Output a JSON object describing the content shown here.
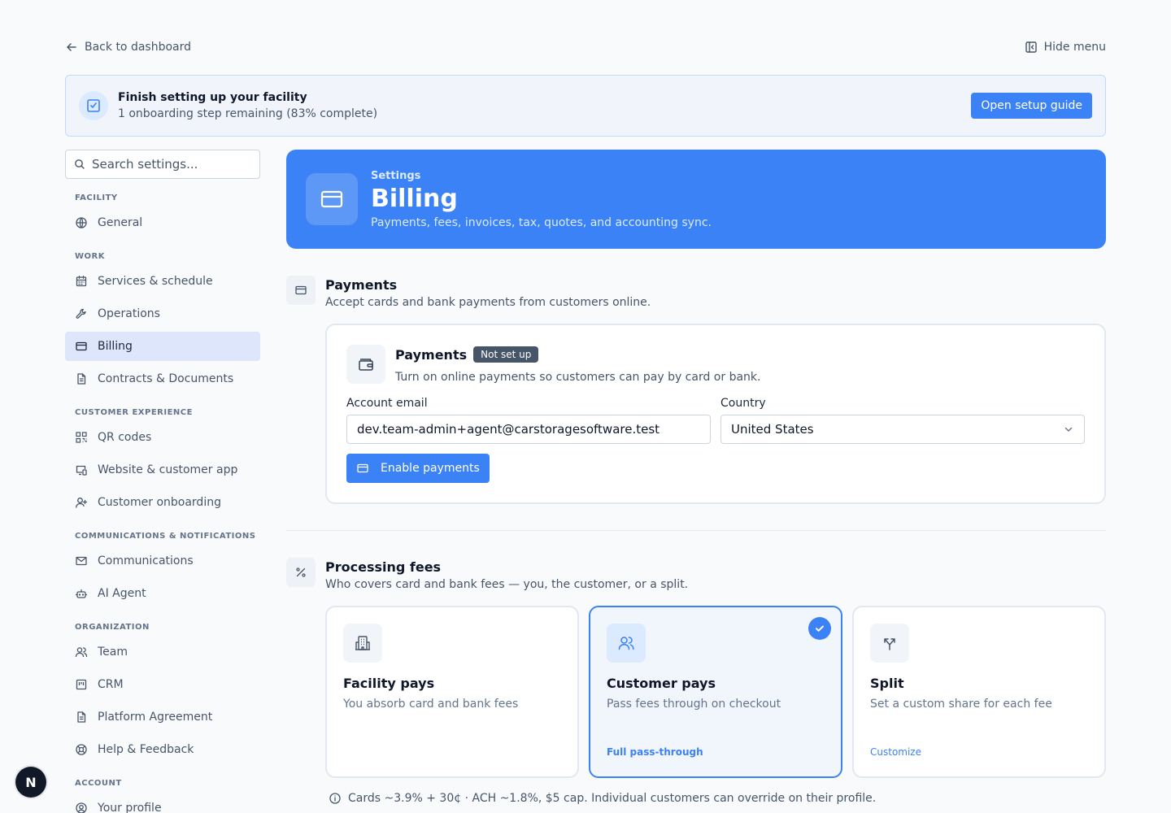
{
  "topbar": {
    "back_label": "Back to dashboard",
    "hide_menu_label": "Hide menu"
  },
  "banner": {
    "title": "Finish setting up your facility",
    "subtitle": "1 onboarding step remaining (83% complete)",
    "button_label": "Open setup guide"
  },
  "sidebar": {
    "search_placeholder": "Search settings...",
    "groups": [
      {
        "label": "FACILITY",
        "items": [
          {
            "label": "General",
            "icon": "globe-icon"
          }
        ]
      },
      {
        "label": "WORK",
        "items": [
          {
            "label": "Services & schedule",
            "icon": "calendar-icon"
          },
          {
            "label": "Operations",
            "icon": "wrench-icon"
          },
          {
            "label": "Billing",
            "icon": "credit-card-icon",
            "active": true
          },
          {
            "label": "Contracts & Documents",
            "icon": "document-icon"
          }
        ]
      },
      {
        "label": "CUSTOMER EXPERIENCE",
        "items": [
          {
            "label": "QR codes",
            "icon": "qr-code-icon"
          },
          {
            "label": "Website & customer app",
            "icon": "devices-icon"
          },
          {
            "label": "Customer onboarding",
            "icon": "user-plus-icon"
          }
        ]
      },
      {
        "label": "COMMUNICATIONS & NOTIFICATIONS",
        "items": [
          {
            "label": "Communications",
            "icon": "mail-icon"
          },
          {
            "label": "AI Agent",
            "icon": "bot-icon"
          }
        ]
      },
      {
        "label": "ORGANIZATION",
        "items": [
          {
            "label": "Team",
            "icon": "users-icon"
          },
          {
            "label": "CRM",
            "icon": "crm-icon"
          },
          {
            "label": "Platform Agreement",
            "icon": "document-icon"
          },
          {
            "label": "Help & Feedback",
            "icon": "lifebuoy-icon"
          }
        ]
      },
      {
        "label": "ACCOUNT",
        "items": [
          {
            "label": "Your profile",
            "icon": "user-circle-icon"
          }
        ]
      }
    ]
  },
  "avatar": {
    "initial": "N"
  },
  "hero": {
    "eyebrow": "Settings",
    "title": "Billing",
    "subtitle": "Payments, fees, invoices, tax, quotes, and accounting sync."
  },
  "payments_section": {
    "title": "Payments",
    "subtitle": "Accept cards and bank payments from customers online.",
    "card": {
      "title": "Payments",
      "badge": "Not set up",
      "subtitle": "Turn on online payments so customers can pay by card or bank.",
      "email_label": "Account email",
      "email_value": "dev.team-admin+agent@carstoragesoftware.test",
      "country_label": "Country",
      "country_value": "United States",
      "enable_label": "Enable payments"
    }
  },
  "fees_section": {
    "title": "Processing fees",
    "subtitle": "Who covers card and bank fees — you, the customer, or a split.",
    "options": [
      {
        "title": "Facility pays",
        "subtitle": "You absorb card and bank fees",
        "link": ""
      },
      {
        "title": "Customer pays",
        "subtitle": "Pass fees through on checkout",
        "link": "Full pass-through",
        "selected": true
      },
      {
        "title": "Split",
        "subtitle": "Set a custom share for each fee",
        "link": "Customize"
      }
    ],
    "footnote": "Cards ~3.9% + 30¢ · ACH ~1.8%, $5 cap. Individual customers can override on their profile."
  },
  "colors": {
    "accent": "#3b82f6",
    "active_nav_bg": "#dde6fb",
    "badge_bg": "#475569"
  }
}
